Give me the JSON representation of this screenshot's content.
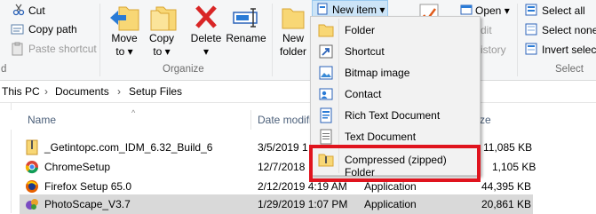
{
  "ribbon": {
    "cut": "Cut",
    "copy_path": "Copy path",
    "paste_shortcut": "Paste shortcut",
    "clipboard_group_tail": "d",
    "move_to": [
      "Move",
      "to ▾"
    ],
    "copy_to": [
      "Copy",
      "to ▾"
    ],
    "delete": [
      "Delete",
      "▾"
    ],
    "rename": "Rename",
    "new_folder": [
      "New",
      "folder"
    ],
    "organize_group": "Organize",
    "new_item": "New item ▾",
    "open": "Open ▾",
    "edit_partial": "dit",
    "history_partial": "istory",
    "select_all": "Select all",
    "select_none": "Select none",
    "invert_selection": "Invert selection",
    "select_group": "Select"
  },
  "address": {
    "crumbs": [
      "This PC",
      "Documents",
      "Setup Files"
    ]
  },
  "columns": {
    "name": "Name",
    "date_partial": "Date modifi",
    "size_partial": "ze"
  },
  "files": [
    {
      "name": "_Getintopc.com_IDM_6.32_Build_6",
      "date": "3/5/2019 1",
      "type": "",
      "size": "11,085 KB"
    },
    {
      "name": "ChromeSetup",
      "date": "12/7/2018",
      "type": "",
      "size": "1,105 KB"
    },
    {
      "name": "Firefox Setup 65.0",
      "date": "2/12/2019 4:19 AM",
      "type": "Application",
      "size": "44,395 KB"
    },
    {
      "name": "PhotoScape_V3.7",
      "date": "1/29/2019 1:07 PM",
      "type": "Application",
      "size": "20,861 KB"
    }
  ],
  "menu": {
    "items": [
      "Folder",
      "Shortcut",
      "Bitmap image",
      "Contact",
      "Rich Text Document",
      "Text Document",
      "Compressed (zipped) Folder"
    ]
  },
  "colors": {
    "highlight_box": "#e0141e",
    "accent": "#0078d7",
    "selected_row": "#d9d9d9"
  }
}
